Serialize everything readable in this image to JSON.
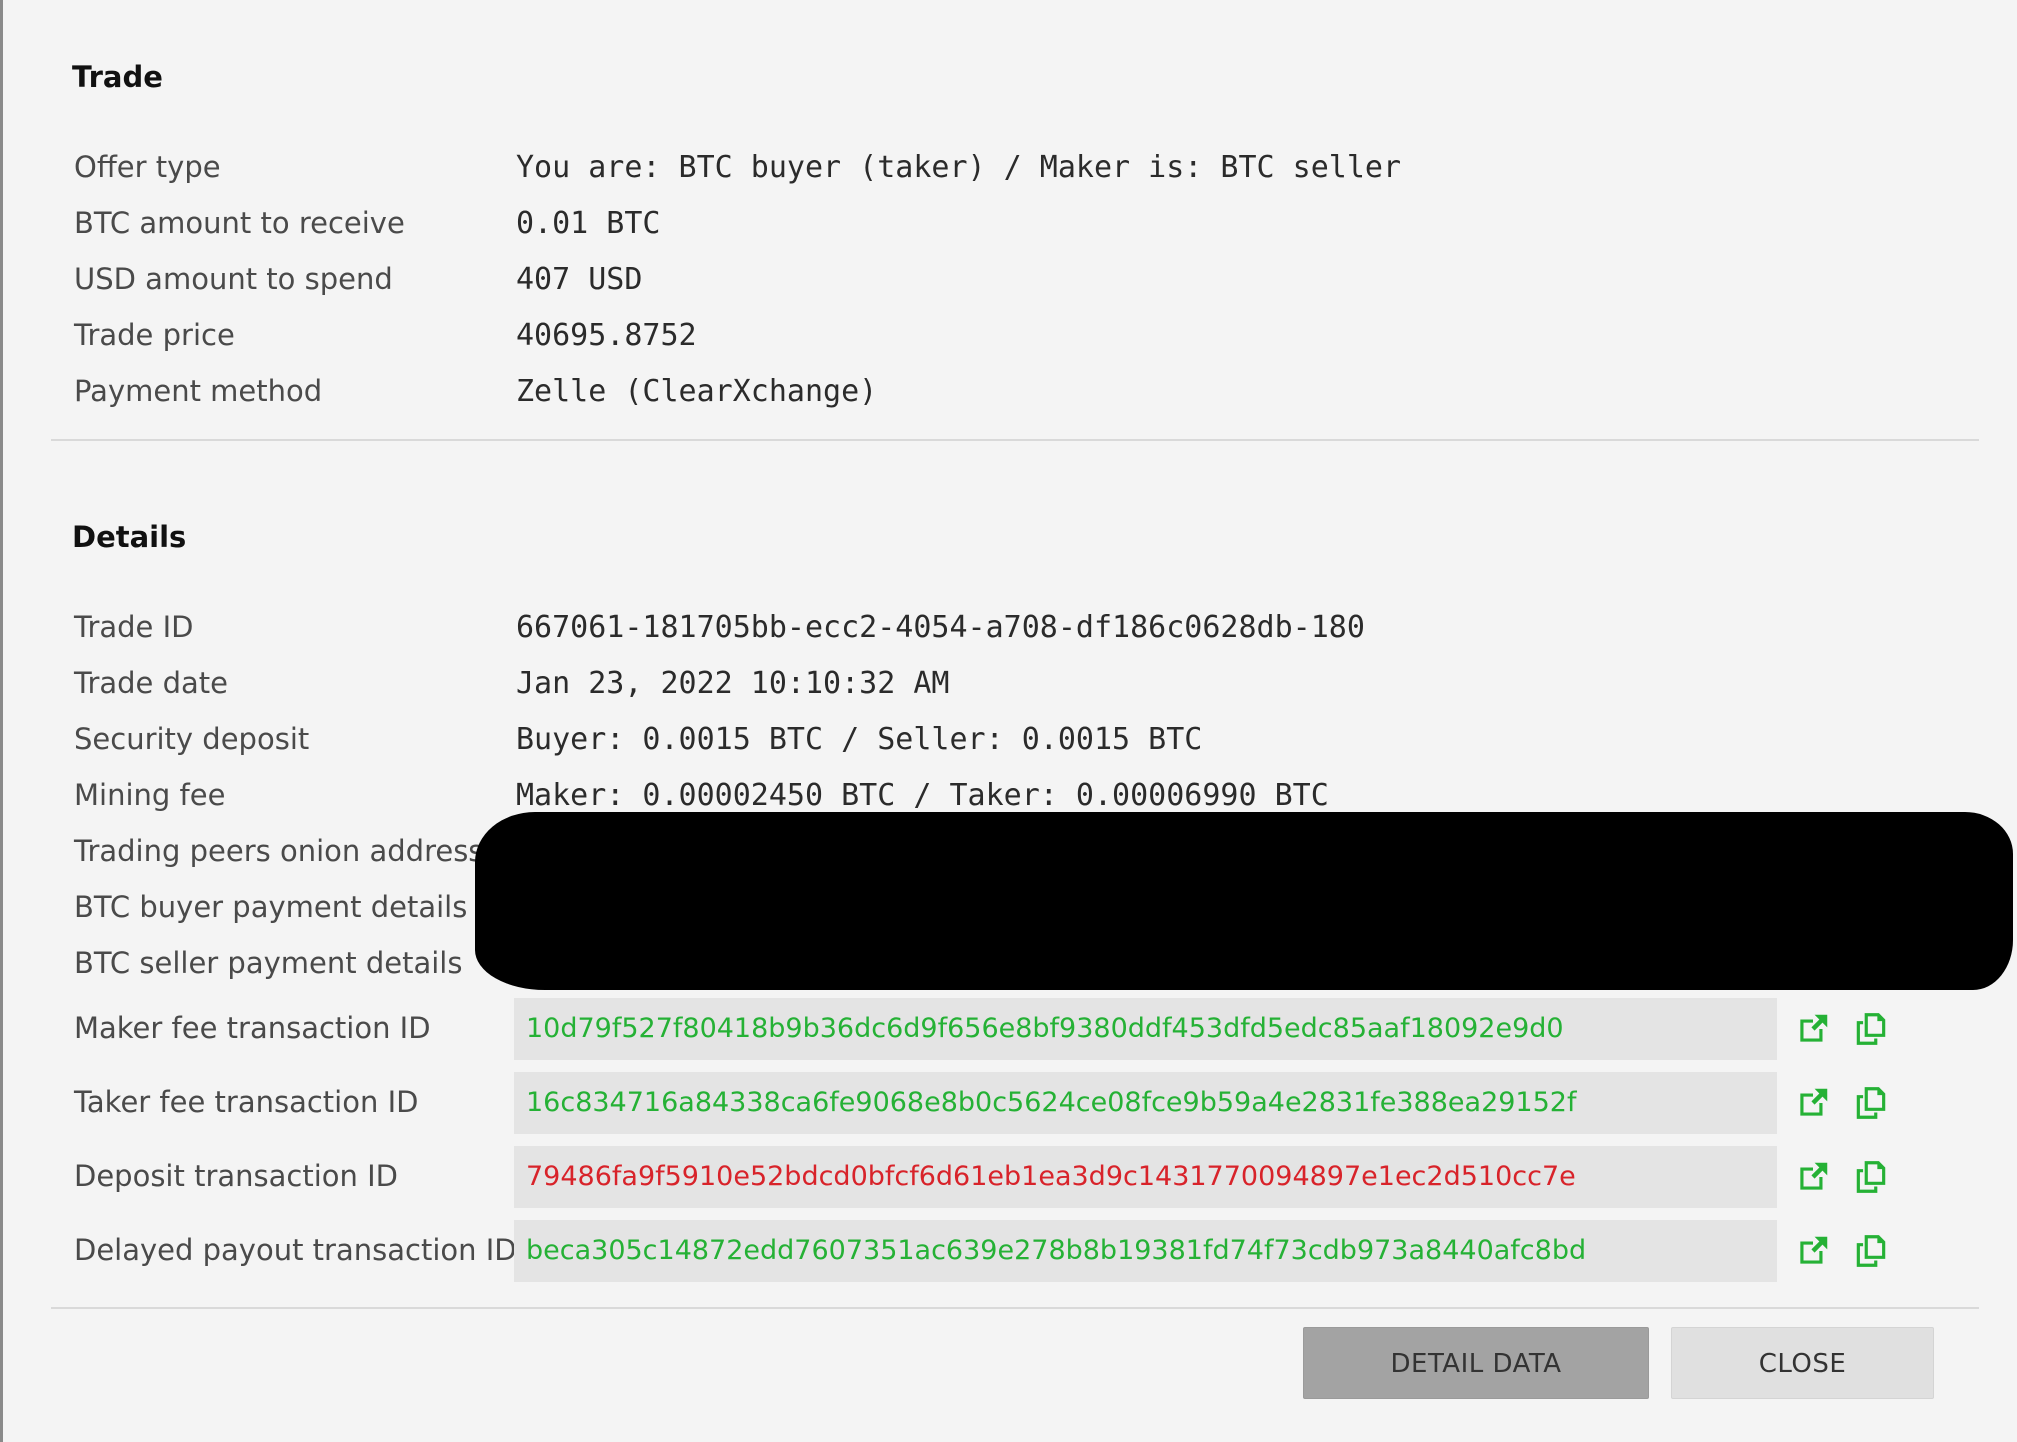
{
  "trade": {
    "title": "Trade",
    "rows": [
      {
        "label": "Offer type",
        "value": "You are: BTC buyer (taker) / Maker is: BTC seller"
      },
      {
        "label": "BTC amount to receive",
        "value": "0.01 BTC"
      },
      {
        "label": "USD amount to spend",
        "value": "407 USD"
      },
      {
        "label": "Trade price",
        "value": "40695.8752"
      },
      {
        "label": "Payment method",
        "value": "Zelle (ClearXchange)"
      }
    ]
  },
  "details": {
    "title": "Details",
    "rows": [
      {
        "label": "Trade ID",
        "value": "667061-181705bb-ecc2-4054-a708-df186c0628db-180"
      },
      {
        "label": "Trade date",
        "value": "Jan 23, 2022 10:10:32 AM"
      },
      {
        "label": "Security deposit",
        "value": "Buyer: 0.0015 BTC / Seller: 0.0015 BTC"
      },
      {
        "label": "Mining fee",
        "value": "Maker: 0.00002450 BTC / Taker: 0.00006990 BTC"
      },
      {
        "label": "Trading peers onion address"
      },
      {
        "label": "BTC buyer payment details"
      },
      {
        "label": "BTC seller payment details"
      }
    ],
    "transactions": [
      {
        "label": "Maker fee transaction ID",
        "value": "10d79f527f80418b9b36dc6d9f656e8bf9380ddf453dfd5edc85aaf18092e9d0",
        "status": "confirmed"
      },
      {
        "label": "Taker fee transaction ID",
        "value": "16c834716a84338ca6fe9068e8b0c5624ce08fce9b59a4e2831fe388ea29152f",
        "status": "confirmed"
      },
      {
        "label": "Deposit transaction ID",
        "value": "79486fa9f5910e52bdcd0bfcf6d61eb1ea3d9c1431770094897e1ec2d510cc7e",
        "status": "unconfirmed"
      },
      {
        "label": "Delayed payout transaction ID",
        "value": "beca305c14872edd7607351ac639e278b8b19381fd74f73cdb973a8440afc8bd",
        "status": "confirmed"
      }
    ]
  },
  "icons": {
    "open": "external-link-icon",
    "copy": "copy-icon",
    "color": "#25b135"
  },
  "colors": {
    "confirmed": "#25b135",
    "unconfirmed": "#d8232a"
  },
  "buttons": {
    "detail_data": "DETAIL DATA",
    "close": "CLOSE"
  }
}
